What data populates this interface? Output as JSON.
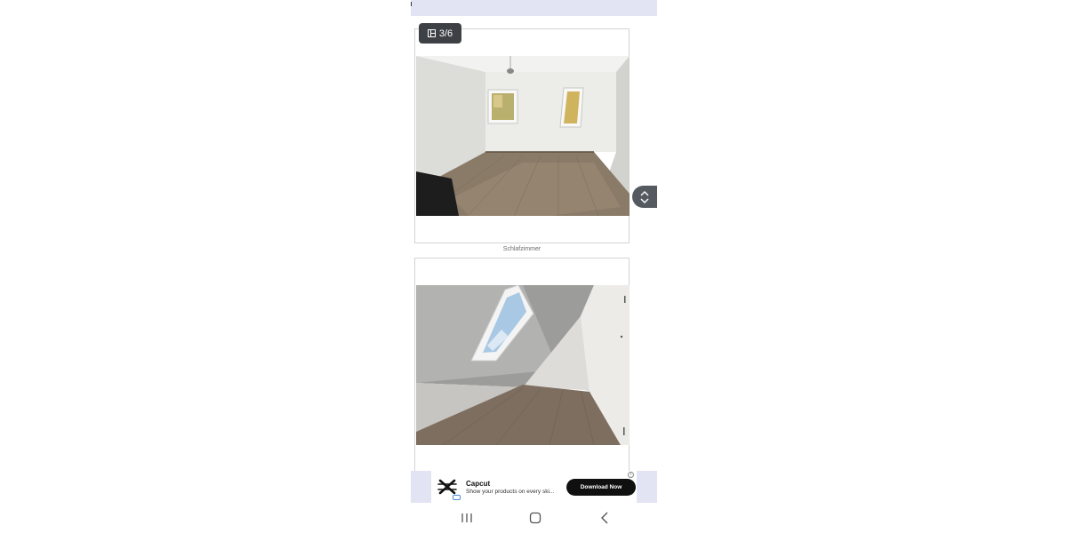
{
  "gallery": {
    "counter": "3/6",
    "photos": [
      {
        "caption": "Schlafzimmer"
      },
      {
        "caption": ""
      }
    ]
  },
  "ad": {
    "title": "Capcut",
    "description": "Show your products on every ski...",
    "cta": "Download Now",
    "info_icon": "i",
    "brand_logo": "capcut-logo"
  },
  "nav": {
    "icons": [
      "recents-icon",
      "home-icon",
      "back-icon"
    ]
  },
  "colors": {
    "banner_bg": "#e3e4f3",
    "badge_bg": "#3d4146",
    "cta_bg": "#101010"
  }
}
